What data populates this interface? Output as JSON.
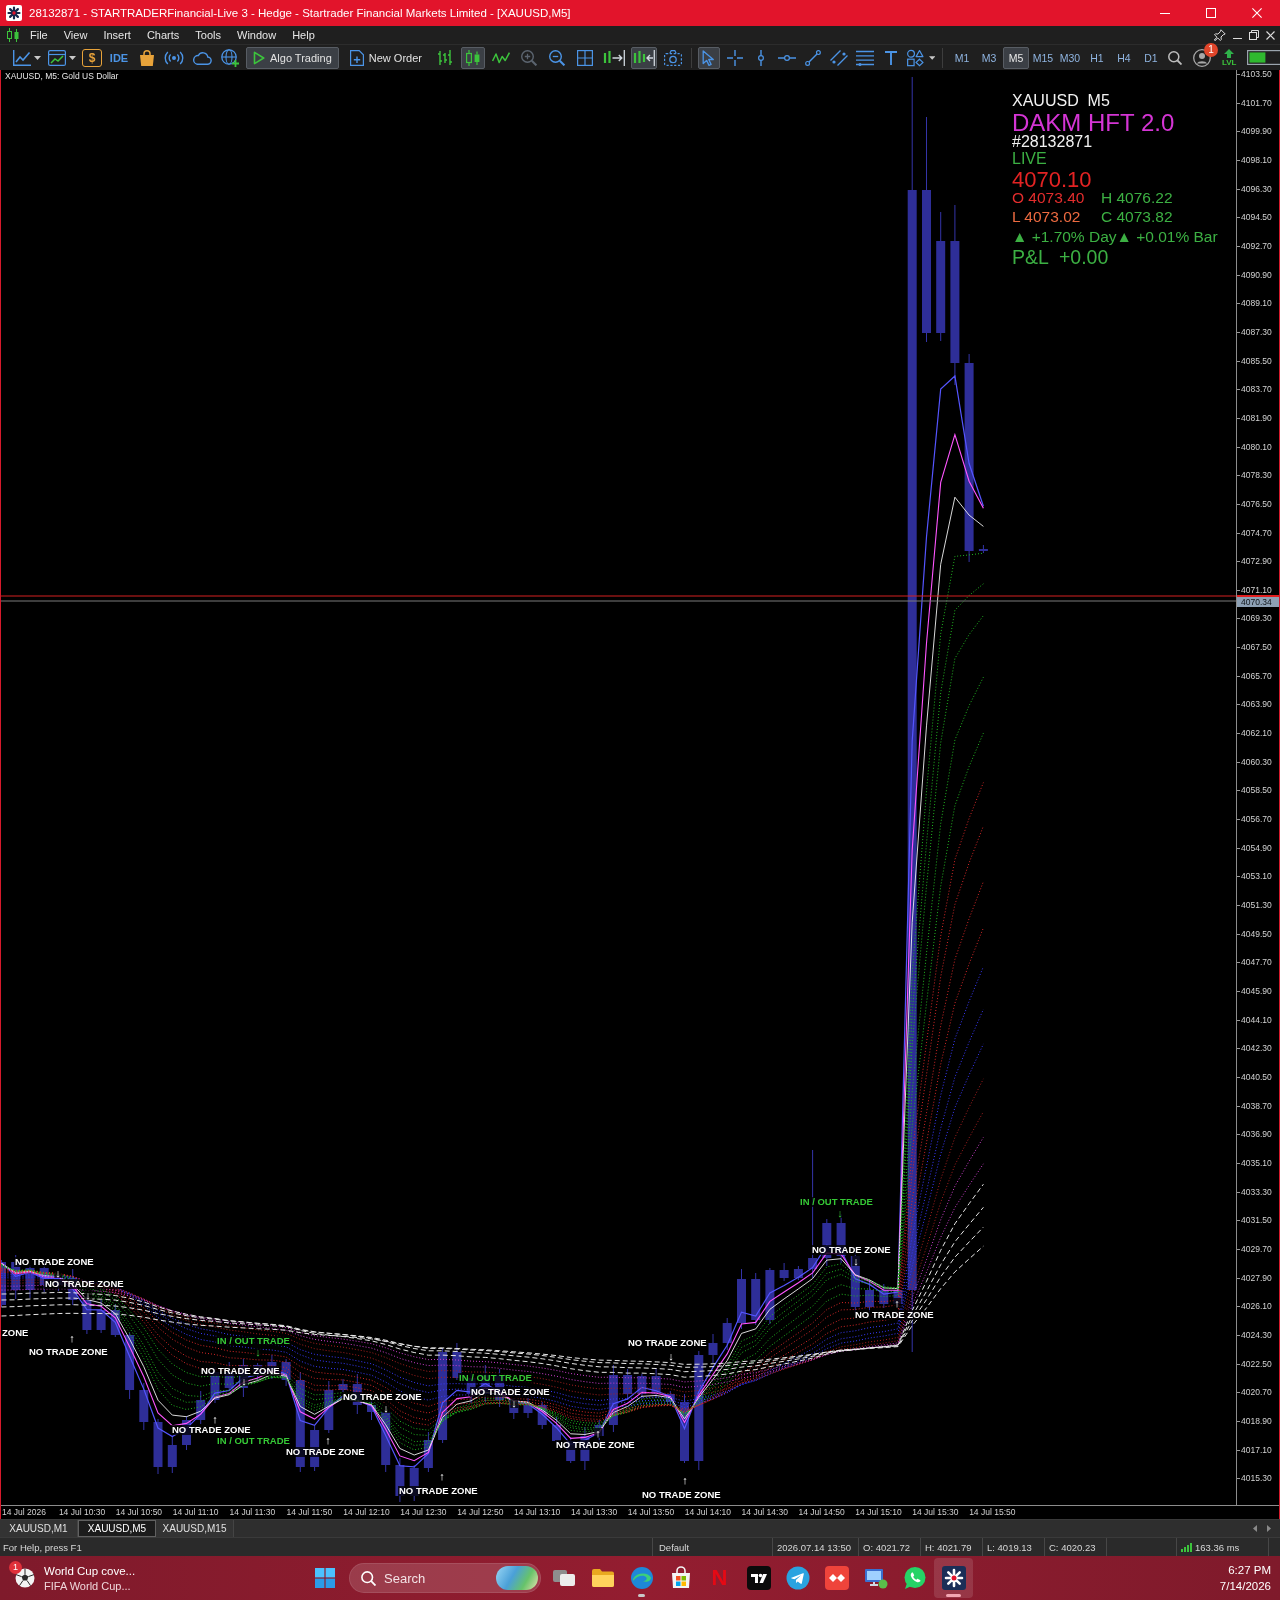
{
  "window": {
    "title": "28132871 - STARTRADERFinancial-Live 3 - Hedge - Startrader Financial Markets Limited - [XAUUSD,M5]"
  },
  "menu": [
    "File",
    "View",
    "Insert",
    "Charts",
    "Tools",
    "Window",
    "Help"
  ],
  "toolbar": {
    "dollar_button": "$",
    "ide_button": "IDE",
    "algo_trading": {
      "label": "Algo Trading",
      "on": true
    },
    "new_order": "New Order",
    "chart_types": [
      {
        "selected": false
      },
      {
        "selected": true
      },
      {
        "selected": false
      }
    ],
    "zoom_buttons": [
      {
        "disabled": true
      },
      {
        "disabled": false
      }
    ],
    "scroll_buttons": [
      {
        "selected": false
      },
      {
        "selected": true
      }
    ],
    "drawing_tools": [
      {
        "selected": true
      },
      {
        "selected": false
      },
      {
        "selected": false
      },
      {
        "selected": false
      },
      {
        "selected": false
      },
      {
        "selected": false
      },
      {
        "selected": false
      },
      {
        "selected": false
      },
      {
        "selected": false
      }
    ],
    "timeframes": [
      {
        "label": "M1",
        "selected": false
      },
      {
        "label": "M3",
        "selected": false
      },
      {
        "label": "M5",
        "selected": true
      },
      {
        "label": "M15",
        "selected": false
      },
      {
        "label": "M30",
        "selected": false
      },
      {
        "label": "H1",
        "selected": false
      },
      {
        "label": "H4",
        "selected": false
      },
      {
        "label": "D1",
        "selected": false
      }
    ],
    "notification_badge": "1",
    "signal_label": "LVL"
  },
  "chart": {
    "caption": "XAUUSD, M5: Gold US Dollar",
    "info_panel": {
      "symbol": "XAUUSD  M5",
      "expert": "DAKM HFT 2.0",
      "account": "#28132871",
      "mode": "LIVE",
      "price": "4070.10",
      "open": "O 4073.40",
      "high": "H 4076.22",
      "low": "L 4073.02",
      "close": "C 4073.82",
      "change": "▲ +1.70% Day▲ +0.01% Bar",
      "pnl": "P&L  +0.00"
    },
    "price_axis": [
      "4103.50",
      "4101.70",
      "4099.90",
      "4098.10",
      "4096.30",
      "4094.50",
      "4092.70",
      "4090.90",
      "4089.10",
      "4087.30",
      "4085.50",
      "4083.70",
      "4081.90",
      "4080.10",
      "4078.30",
      "4076.50",
      "4074.70",
      "4072.90",
      "4071.10",
      "4069.30",
      "4067.50",
      "4065.70",
      "4063.90",
      "4062.10",
      "4060.30",
      "4058.50",
      "4056.70",
      "4054.90",
      "4053.10",
      "4051.30",
      "4049.50",
      "4047.70",
      "4045.90",
      "4044.10",
      "4042.30",
      "4040.50",
      "4038.70",
      "4036.90",
      "4035.10",
      "4033.30",
      "4031.50",
      "4029.70",
      "4027.90",
      "4026.10",
      "4024.30",
      "4022.50",
      "4020.70",
      "4018.90",
      "4017.10",
      "4015.30"
    ],
    "current_price": "4070.34",
    "time_axis": [
      "14 Jul 2026",
      "14 Jul 10:30",
      "14 Jul 10:50",
      "14 Jul 11:10",
      "14 Jul 11:30",
      "14 Jul 11:50",
      "14 Jul 12:10",
      "14 Jul 12:30",
      "14 Jul 12:50",
      "14 Jul 13:10",
      "14 Jul 13:30",
      "14 Jul 13:50",
      "14 Jul 14:10",
      "14 Jul 14:30",
      "14 Jul 14:50",
      "14 Jul 15:10",
      "14 Jul 15:30",
      "14 Jul 15:50"
    ],
    "signals": [
      {
        "kind": "no_trade",
        "text": "NO TRADE ZONE",
        "arrow": "↓"
      },
      {
        "kind": "no_trade",
        "text": "NO TRADE ZONE",
        "arrow": "↓"
      },
      {
        "kind": "no_trade",
        "text": "ZONE"
      },
      {
        "kind": "no_trade",
        "text": "NO TRADE ZONE",
        "arrow": "↑"
      },
      {
        "kind": "in_out",
        "text": "IN / OUT TRADE",
        "arrow": "↓"
      },
      {
        "kind": "no_trade",
        "text": "NO TRADE ZONE",
        "arrow": "↓"
      },
      {
        "kind": "no_trade",
        "text": "NO TRADE ZONE",
        "arrow": "↓"
      },
      {
        "kind": "in_out",
        "text": "IN / OUT TRADE"
      },
      {
        "kind": "no_trade",
        "text": "NO TRADE ZONE",
        "arrow": "↓"
      },
      {
        "kind": "no_trade",
        "text": "NO TRADE ZONE",
        "arrow": "↑"
      },
      {
        "kind": "in_out",
        "text": "IN / OUT TRADE"
      },
      {
        "kind": "no_trade",
        "text": "NO TRADE ZONE",
        "arrow": "↑"
      },
      {
        "kind": "no_trade",
        "text": "NO TRADE ZONE",
        "arrow": "↑"
      },
      {
        "kind": "no_trade",
        "text": "NO TRADE ZONE",
        "arrow": "↑"
      },
      {
        "kind": "no_trade",
        "text": "NO TRADE ZONE",
        "arrow": "↓"
      },
      {
        "kind": "no_trade",
        "text": "NO TRADE ZONE",
        "arrow": "↑"
      },
      {
        "kind": "in_out",
        "text": "IN / OUT TRADE",
        "arrow": "↓"
      },
      {
        "kind": "no_trade",
        "text": "NO TRADE ZONE",
        "arrow": "↓"
      },
      {
        "kind": "no_trade",
        "text": "NO TRADE ZONE",
        "arrow": "↑"
      }
    ]
  },
  "chart_tabs": [
    {
      "label": "XAUUSD,M1",
      "selected": false
    },
    {
      "label": "XAUUSD,M5",
      "selected": true
    },
    {
      "label": "XAUUSD,M15",
      "selected": false
    }
  ],
  "status_bar": {
    "help": "For Help, press F1",
    "profile": "Default",
    "time": "2026.07.14 13:50",
    "open": "O: 4021.72",
    "high": "H: 4021.79",
    "low": "L: 4019.13",
    "close": "C: 4020.23",
    "ping": "163.36 ms"
  },
  "taskbar": {
    "widget": {
      "badge": "1",
      "title": "World Cup cove...",
      "subtitle": "FIFA World Cup..."
    },
    "search": {
      "placeholder": "Search"
    },
    "apps": [
      {
        "running": false,
        "active": false
      },
      {
        "running": false,
        "active": false
      },
      {
        "running": true,
        "active": false
      },
      {
        "running": false,
        "active": false
      },
      {
        "label": "N",
        "running": false,
        "active": false
      },
      {
        "running": false,
        "active": false
      },
      {
        "running": false,
        "active": false
      },
      {
        "running": false,
        "active": false
      },
      {
        "running": false,
        "active": false
      },
      {
        "running": false,
        "active": false
      },
      {
        "running": true,
        "active": true
      }
    ],
    "clock": {
      "time": "6:27 PM",
      "date": "7/14/2026"
    }
  }
}
